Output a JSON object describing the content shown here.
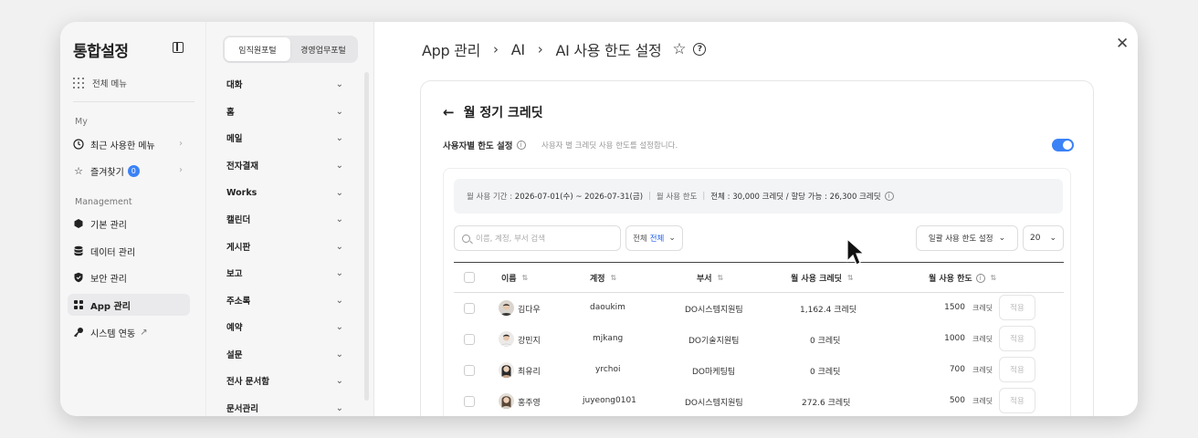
{
  "sidebar": {
    "title": "통합설정",
    "all_menu": "전체 메뉴",
    "section_my": "My",
    "recent": "최근 사용한 메뉴",
    "favorites": "즐겨찾기",
    "favorites_count": "0",
    "section_management": "Management",
    "items": [
      {
        "label": "기본 관리"
      },
      {
        "label": "데이터 관리"
      },
      {
        "label": "보안 관리"
      },
      {
        "label": "App 관리"
      },
      {
        "label": "시스템 연동"
      }
    ]
  },
  "portal_tabs": [
    "임직원포털",
    "경영업무포털"
  ],
  "menu": [
    "대화",
    "홈",
    "메일",
    "전자결재",
    "Works",
    "캘린더",
    "게시판",
    "보고",
    "주소록",
    "예약",
    "설문",
    "전사 문서함",
    "문서관리"
  ],
  "breadcrumb": [
    "App 관리",
    "AI",
    "AI 사용 한도 설정"
  ],
  "page": {
    "title": "월 정기 크레딧",
    "limit_label": "사용자별 한도 설정",
    "limit_desc": "사용자 별 크레딧 사용 한도를 설정합니다.",
    "toggle_on": true,
    "period_label": "월 사용 기간 :",
    "period_value": "2026-07-01(수) ~ 2026-07-31(금)",
    "monthly_limit_label": "월 사용 한도",
    "total_text": "전체 : 30,000 크레딧 / 할당 가능 : 26,300 크레딧",
    "search_placeholder": "이름, 계정, 부서 검색",
    "filter_label": "전체",
    "filter_value": "전체",
    "bulk_button": "일괄 사용 한도 설정",
    "page_size": "20"
  },
  "table": {
    "headers": [
      "이름",
      "계정",
      "부서",
      "월 사용 크레딧",
      "월 사용 한도"
    ],
    "unit": "크레딧",
    "apply_label": "적용",
    "rows": [
      {
        "name": "김다우",
        "account": "daoukim",
        "dept": "DO시스템지원팀",
        "used": "1,162.4 크레딧",
        "limit": "1500"
      },
      {
        "name": "강민지",
        "account": "mjkang",
        "dept": "DO기술지원팀",
        "used": "0 크레딧",
        "limit": "1000"
      },
      {
        "name": "최유리",
        "account": "yrchoi",
        "dept": "DO마케팅팀",
        "used": "0 크레딧",
        "limit": "700"
      },
      {
        "name": "홍주영",
        "account": "juyeong0101",
        "dept": "DO시스템지원팀",
        "used": "272.6 크레딧",
        "limit": "500"
      }
    ]
  },
  "colors": {
    "accent": "#3b82f6",
    "link": "#2563eb"
  }
}
